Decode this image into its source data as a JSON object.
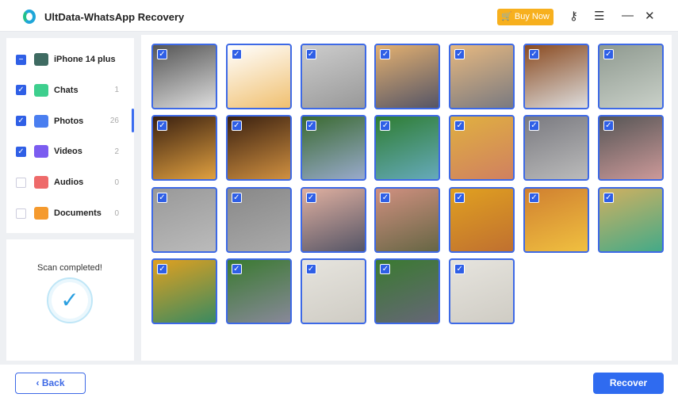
{
  "app": {
    "title": "UltData-WhatsApp Recovery",
    "buy_now": "Buy Now",
    "accent": "#2f6bf0"
  },
  "sidebar": {
    "items": [
      {
        "label": "iPhone 14 plus",
        "count": "",
        "state": "partial",
        "icon": "phone-icon",
        "color": "#3f6b62"
      },
      {
        "label": "Chats",
        "count": "1",
        "state": "checked",
        "icon": "chat-icon",
        "color": "#3ecf8e"
      },
      {
        "label": "Photos",
        "count": "26",
        "state": "checked",
        "icon": "photo-icon",
        "color": "#4a7ef0"
      },
      {
        "label": "Videos",
        "count": "2",
        "state": "checked",
        "icon": "video-icon",
        "color": "#7b5cf0"
      },
      {
        "label": "Audios",
        "count": "0",
        "state": "unchecked",
        "icon": "music-icon",
        "color": "#ee6a6a"
      },
      {
        "label": "Documents",
        "count": "0",
        "state": "unchecked",
        "icon": "folder-icon",
        "color": "#f59a2e"
      }
    ]
  },
  "scan": {
    "status": "Scan completed!"
  },
  "photos": [
    {
      "c": [
        "#555",
        "#ddd"
      ]
    },
    {
      "c": [
        "#fff",
        "#f0c070"
      ]
    },
    {
      "c": [
        "#ccc",
        "#999"
      ]
    },
    {
      "c": [
        "#e3b070",
        "#556"
      ]
    },
    {
      "c": [
        "#e6b880",
        "#7a7a80"
      ]
    },
    {
      "c": [
        "#8a4a20",
        "#ddd"
      ]
    },
    {
      "c": [
        "#8f9a90",
        "#c9d0c8"
      ]
    },
    {
      "c": [
        "#3a2010",
        "#e0a040"
      ]
    },
    {
      "c": [
        "#3a2010",
        "#d09040"
      ]
    },
    {
      "c": [
        "#3a6a30",
        "#9ac"
      ]
    },
    {
      "c": [
        "#2e7d32",
        "#6ab"
      ]
    },
    {
      "c": [
        "#e0b040",
        "#d08060"
      ]
    },
    {
      "c": [
        "#7a7a80",
        "#bbb"
      ]
    },
    {
      "c": [
        "#555",
        "#c99"
      ]
    },
    {
      "c": [
        "#999",
        "#bbb"
      ]
    },
    {
      "c": [
        "#888",
        "#aaa"
      ]
    },
    {
      "c": [
        "#e0b0a0",
        "#556"
      ]
    },
    {
      "c": [
        "#d09080",
        "#664"
      ]
    },
    {
      "c": [
        "#e0a020",
        "#c07030"
      ]
    },
    {
      "c": [
        "#d08030",
        "#f0c040"
      ]
    },
    {
      "c": [
        "#d0b060",
        "#4a8"
      ]
    },
    {
      "c": [
        "#e0a020",
        "#3a8a60"
      ]
    },
    {
      "c": [
        "#3a7a30",
        "#889"
      ]
    },
    {
      "c": [
        "#e6e4de",
        "#cfccc4"
      ]
    },
    {
      "c": [
        "#3a7a30",
        "#667"
      ]
    },
    {
      "c": [
        "#e6e4de",
        "#cfccc4"
      ]
    }
  ],
  "footer": {
    "back": "Back",
    "recover": "Recover"
  }
}
